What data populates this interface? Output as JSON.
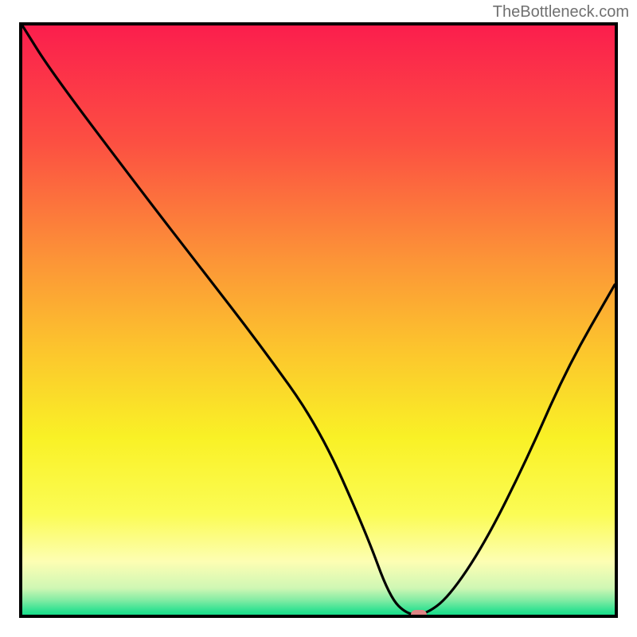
{
  "watermark": "TheBottleneck.com",
  "chart_data": {
    "type": "line",
    "title": "",
    "xlabel": "",
    "ylabel": "",
    "xlim": [
      0,
      100
    ],
    "ylim": [
      0,
      100
    ],
    "x": [
      0,
      5,
      20,
      30,
      40,
      50,
      58,
      62,
      65,
      68,
      72,
      78,
      85,
      92,
      100
    ],
    "values": [
      100,
      92,
      72,
      59,
      46,
      32,
      14,
      3,
      0,
      0,
      3,
      12,
      26,
      42,
      56
    ],
    "marker": {
      "x": 67,
      "y": 0,
      "color": "#df8585"
    },
    "background_gradient": {
      "stops": [
        {
          "pos": 0.0,
          "color": "#fb1e4d"
        },
        {
          "pos": 0.2,
          "color": "#fc5042"
        },
        {
          "pos": 0.4,
          "color": "#fc9537"
        },
        {
          "pos": 0.55,
          "color": "#fcc52d"
        },
        {
          "pos": 0.7,
          "color": "#f9f126"
        },
        {
          "pos": 0.83,
          "color": "#fbfc55"
        },
        {
          "pos": 0.91,
          "color": "#fdfeb3"
        },
        {
          "pos": 0.955,
          "color": "#cff7b4"
        },
        {
          "pos": 0.975,
          "color": "#84eca4"
        },
        {
          "pos": 0.99,
          "color": "#3de394"
        },
        {
          "pos": 1.0,
          "color": "#18df8b"
        }
      ]
    }
  }
}
